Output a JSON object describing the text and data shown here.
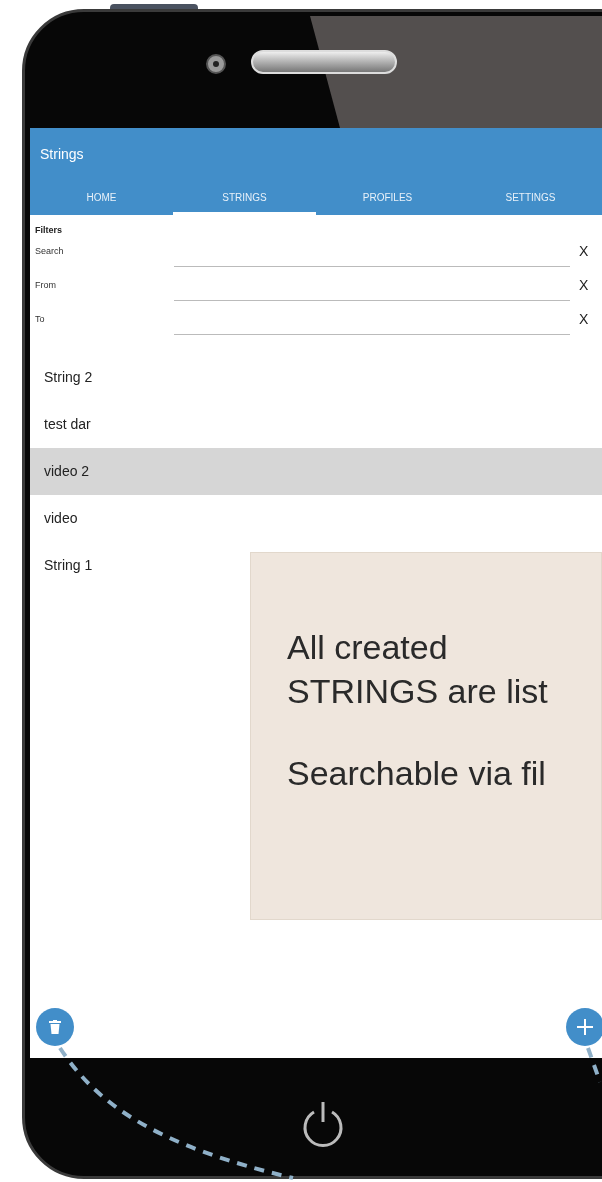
{
  "app_bar": {
    "title": "Strings"
  },
  "tabs": [
    {
      "label": "HOME",
      "selected": false
    },
    {
      "label": "STRINGS",
      "selected": true
    },
    {
      "label": "PROFILES",
      "selected": false
    },
    {
      "label": "SETTINGS",
      "selected": false
    }
  ],
  "filters": {
    "heading": "Filters",
    "fields": [
      {
        "label": "Search",
        "clear": "X"
      },
      {
        "label": "From",
        "clear": "X"
      },
      {
        "label": "To",
        "clear": "X"
      }
    ]
  },
  "strings": [
    {
      "name": "String 2",
      "selected": false
    },
    {
      "name": "test dar",
      "selected": false
    },
    {
      "name": "video 2",
      "selected": true
    },
    {
      "name": "video",
      "selected": false
    },
    {
      "name": "String 1",
      "selected": false
    }
  ],
  "annotation": {
    "paragraphs": [
      [
        "All created",
        "STRINGS are list"
      ],
      [
        "Searchable via fil"
      ]
    ]
  }
}
